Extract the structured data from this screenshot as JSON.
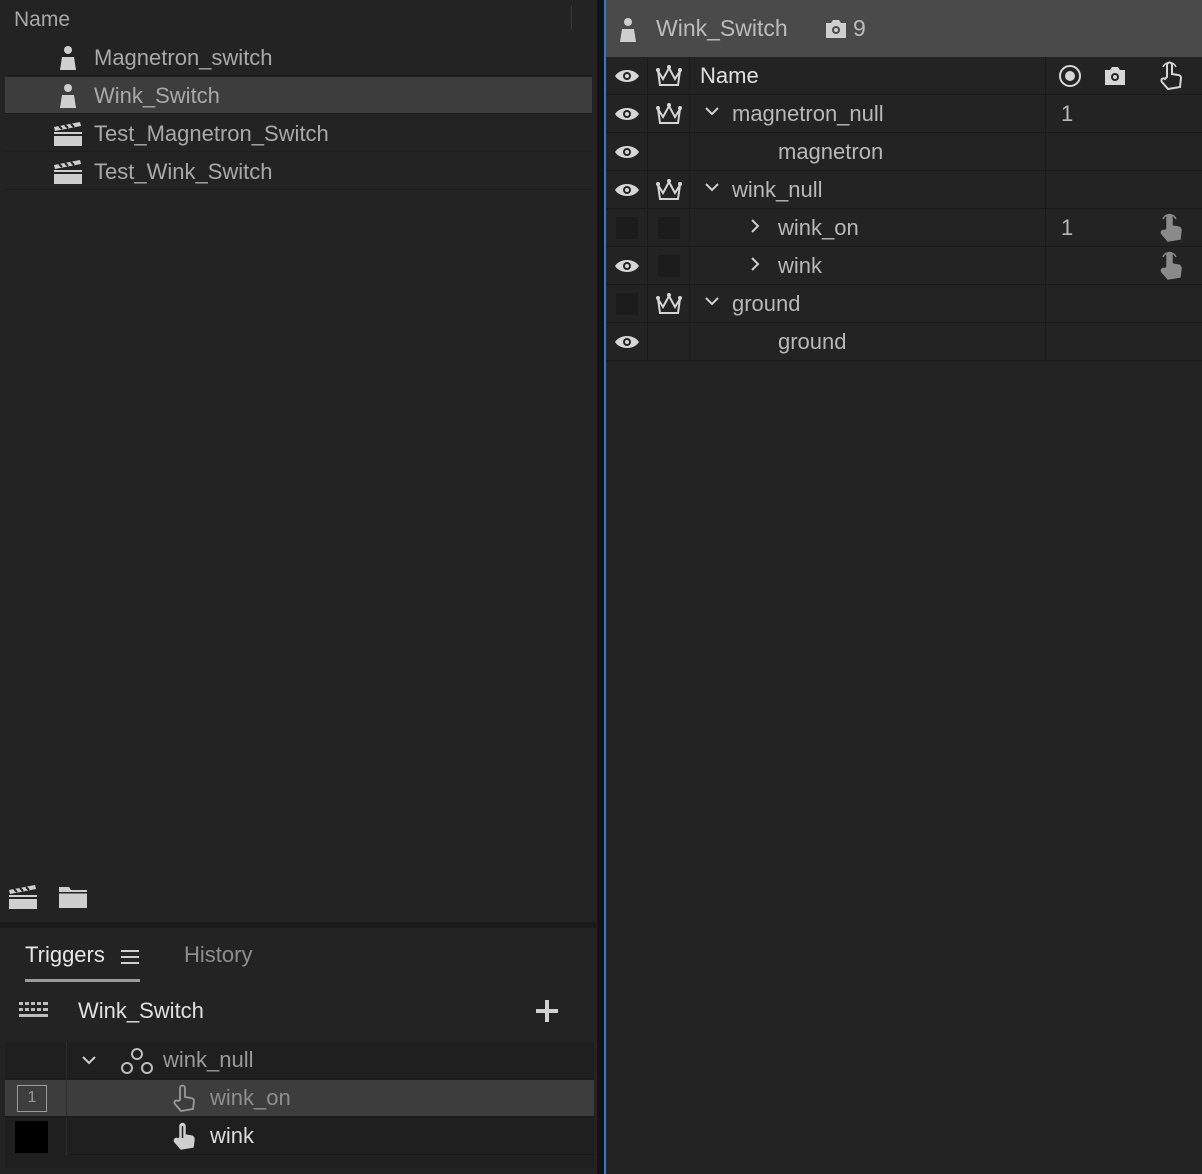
{
  "project": {
    "header": "Name",
    "items": [
      {
        "label": "Magnetron_switch",
        "icon": "puppet-icon",
        "selected": false
      },
      {
        "label": "Wink_Switch",
        "icon": "puppet-icon",
        "selected": true
      },
      {
        "label": "Test_Magnetron_Switch",
        "icon": "scene-clapper-icon",
        "selected": false
      },
      {
        "label": "Test_Wink_Switch",
        "icon": "scene-clapper-icon",
        "selected": false
      }
    ],
    "footer": [
      "new-scene-icon",
      "new-folder-icon"
    ]
  },
  "triggers_panel": {
    "tabs": [
      {
        "label": "Triggers",
        "active": true
      },
      {
        "label": "History",
        "active": false
      }
    ],
    "puppet_name": "Wink_Switch",
    "tree": [
      {
        "label": "wink_null",
        "key": "",
        "type": "group"
      },
      {
        "label": "wink_on",
        "key": "1",
        "type": "trigger",
        "selected": true
      },
      {
        "label": "wink",
        "key": "",
        "type": "trigger",
        "selected": false
      }
    ]
  },
  "puppet_panel": {
    "title": "Wink_Switch",
    "camera_count": "9",
    "columns": {
      "name": "Name"
    },
    "rows": [
      {
        "name": "magnetron_null",
        "eye": true,
        "crown": true,
        "expand": "open",
        "record": "1",
        "touch": false
      },
      {
        "name": "magnetron",
        "eye": true,
        "crown": false,
        "expand": "none",
        "record": "",
        "touch": false
      },
      {
        "name": "wink_null",
        "eye": true,
        "crown": true,
        "expand": "open",
        "record": "",
        "touch": false
      },
      {
        "name": "wink_on",
        "eye": false,
        "crown": false,
        "expand": "closed",
        "record": "1",
        "touch": true
      },
      {
        "name": "wink",
        "eye": true,
        "crown": false,
        "expand": "closed",
        "record": "",
        "touch": true
      },
      {
        "name": "ground",
        "eye": false,
        "crown": true,
        "expand": "open",
        "record": "",
        "touch": false
      },
      {
        "name": "ground",
        "eye": true,
        "crown": false,
        "expand": "none",
        "record": "",
        "touch": false
      }
    ]
  },
  "colors": {
    "selection": "#3d3d3d",
    "focus": "#2d7ad6",
    "title_bar": "#4a4a4a"
  }
}
